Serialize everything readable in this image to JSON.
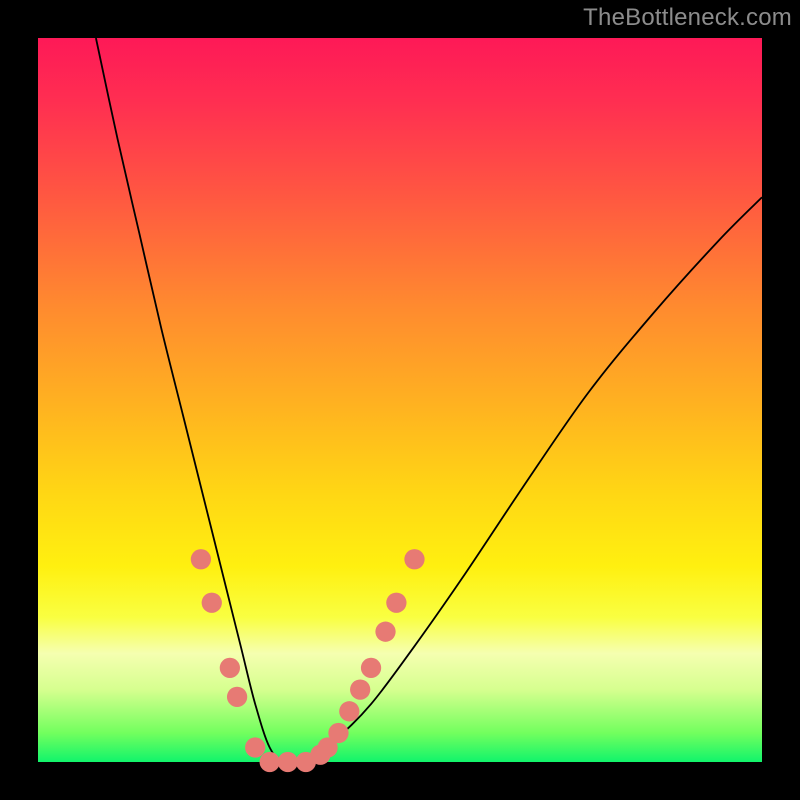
{
  "watermark": "TheBottleneck.com",
  "chart_data": {
    "type": "line",
    "title": "",
    "xlabel": "",
    "ylabel": "",
    "xlim": [
      0,
      100
    ],
    "ylim": [
      0,
      100
    ],
    "grid": false,
    "legend": false,
    "background_gradient_stops": [
      {
        "pos": 0,
        "color": "#fe1957"
      },
      {
        "pos": 9,
        "color": "#ff2f51"
      },
      {
        "pos": 22,
        "color": "#ff5841"
      },
      {
        "pos": 37,
        "color": "#ff8a2f"
      },
      {
        "pos": 52,
        "color": "#ffb61f"
      },
      {
        "pos": 63,
        "color": "#ffd714"
      },
      {
        "pos": 73,
        "color": "#fff010"
      },
      {
        "pos": 80,
        "color": "#f9ff41"
      },
      {
        "pos": 85,
        "color": "#f5ffb0"
      },
      {
        "pos": 90,
        "color": "#d6ff8f"
      },
      {
        "pos": 96,
        "color": "#72ff5e"
      },
      {
        "pos": 100,
        "color": "#11f46b"
      }
    ],
    "series": [
      {
        "name": "bottleneck-curve",
        "color": "#000000",
        "x": [
          8,
          11,
          14,
          17,
          20,
          23,
          26,
          28,
          30,
          32,
          34,
          37,
          41,
          46,
          52,
          59,
          67,
          76,
          85,
          94,
          100
        ],
        "y": [
          100,
          86,
          73,
          60,
          48,
          36,
          24,
          16,
          8,
          2,
          0,
          0,
          3,
          8,
          16,
          26,
          38,
          51,
          62,
          72,
          78
        ]
      }
    ],
    "markers": {
      "name": "highlight-dots",
      "color": "#e77a74",
      "radius_plot_units": 1.4,
      "points": [
        {
          "x": 22.5,
          "y": 28
        },
        {
          "x": 24.0,
          "y": 22
        },
        {
          "x": 26.5,
          "y": 13
        },
        {
          "x": 27.5,
          "y": 9
        },
        {
          "x": 30.0,
          "y": 2
        },
        {
          "x": 32.0,
          "y": 0
        },
        {
          "x": 34.5,
          "y": 0
        },
        {
          "x": 37.0,
          "y": 0
        },
        {
          "x": 39.0,
          "y": 1
        },
        {
          "x": 40.0,
          "y": 2
        },
        {
          "x": 41.5,
          "y": 4
        },
        {
          "x": 43.0,
          "y": 7
        },
        {
          "x": 44.5,
          "y": 10
        },
        {
          "x": 46.0,
          "y": 13
        },
        {
          "x": 48.0,
          "y": 18
        },
        {
          "x": 49.5,
          "y": 22
        },
        {
          "x": 52.0,
          "y": 28
        }
      ]
    }
  }
}
